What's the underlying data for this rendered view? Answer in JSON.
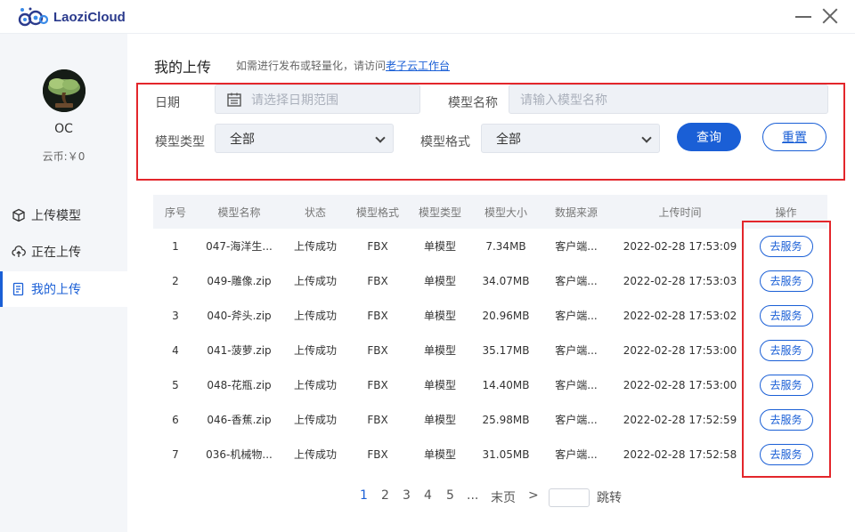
{
  "app": {
    "name": "LaoziCloud"
  },
  "user": {
    "name": "OC",
    "coins": "云币:￥0"
  },
  "nav": [
    {
      "label": "上传模型",
      "icon": "cube-icon"
    },
    {
      "label": "正在上传",
      "icon": "cloud-upload-icon"
    },
    {
      "label": "我的上传",
      "icon": "document-icon"
    }
  ],
  "page": {
    "title": "我的上传",
    "hint": "如需进行发布或轻量化，请访问",
    "hint_link": "老子云工作台"
  },
  "filters": {
    "date_label": "日期",
    "date_placeholder": "请选择日期范围",
    "name_label": "模型名称",
    "name_placeholder": "请输入模型名称",
    "type_label": "模型类型",
    "type_value": "全部",
    "format_label": "模型格式",
    "format_value": "全部",
    "query_label": "查询",
    "reset_label": "重置"
  },
  "table": {
    "headers": [
      "序号",
      "模型名称",
      "状态",
      "模型格式",
      "模型类型",
      "模型大小",
      "数据来源",
      "上传时间",
      "操作"
    ],
    "action_label": "去服务",
    "rows": [
      [
        "1",
        "047-海洋生...",
        "上传成功",
        "FBX",
        "单模型",
        "7.34MB",
        "客户端...",
        "2022-02-28 17:53:09"
      ],
      [
        "2",
        "049-雕像.zip",
        "上传成功",
        "FBX",
        "单模型",
        "34.07MB",
        "客户端...",
        "2022-02-28 17:53:03"
      ],
      [
        "3",
        "040-斧头.zip",
        "上传成功",
        "FBX",
        "单模型",
        "20.96MB",
        "客户端...",
        "2022-02-28 17:53:02"
      ],
      [
        "4",
        "041-菠萝.zip",
        "上传成功",
        "FBX",
        "单模型",
        "35.17MB",
        "客户端...",
        "2022-02-28 17:53:00"
      ],
      [
        "5",
        "048-花瓶.zip",
        "上传成功",
        "FBX",
        "单模型",
        "14.40MB",
        "客户端...",
        "2022-02-28 17:53:00"
      ],
      [
        "6",
        "046-香蕉.zip",
        "上传成功",
        "FBX",
        "单模型",
        "25.98MB",
        "客户端...",
        "2022-02-28 17:52:59"
      ],
      [
        "7",
        "036-机械物...",
        "上传成功",
        "FBX",
        "单模型",
        "31.05MB",
        "客户端...",
        "2022-02-28 17:52:58"
      ]
    ]
  },
  "pagination": {
    "pages": [
      "1",
      "2",
      "3",
      "4",
      "5"
    ],
    "ellipsis": "...",
    "last": "末页",
    "next": ">",
    "jump": "跳转",
    "current": "1"
  },
  "colors": {
    "accent": "#1a5fd6",
    "highlight": "#e3262b",
    "sidebar_bg": "#f4f6f9"
  }
}
